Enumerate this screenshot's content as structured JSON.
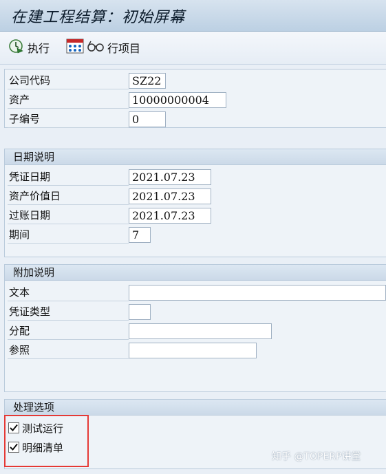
{
  "window": {
    "title": "在建工程结算：初始屏幕"
  },
  "toolbar": {
    "execute_label": "执行",
    "line_items_label": "行项目",
    "execute_icon": "clock-execute-icon",
    "line_items_icons": [
      "grid-icon",
      "glasses-icon"
    ]
  },
  "main": {
    "fields": {
      "company_code": {
        "label": "公司代码",
        "value": "SZ22"
      },
      "asset": {
        "label": "资产",
        "value": "10000000004"
      },
      "sub_number": {
        "label": "子编号",
        "value": "0"
      }
    }
  },
  "dates": {
    "header": "日期说明",
    "document_date": {
      "label": "凭证日期",
      "value": "2021.07.23"
    },
    "asset_value_date": {
      "label": "资产价值日",
      "value": "2021.07.23"
    },
    "posting_date": {
      "label": "过账日期",
      "value": "2021.07.23"
    },
    "period": {
      "label": "期间",
      "value": "7"
    }
  },
  "additional": {
    "header": "附加说明",
    "text": {
      "label": "文本",
      "value": ""
    },
    "document_type": {
      "label": "凭证类型",
      "value": ""
    },
    "assignment": {
      "label": "分配",
      "value": ""
    },
    "reference": {
      "label": "参照",
      "value": ""
    }
  },
  "processing": {
    "header": "处理选项",
    "test_run": {
      "label": "测试运行",
      "checked": true
    },
    "detail_list": {
      "label": "明细清单",
      "checked": true
    }
  },
  "watermark": {
    "text": "知乎 @TOPERP讲堂"
  },
  "colors": {
    "highlight_border": "#e53935",
    "title_bg": "#c8d8e8",
    "panel_bg": "#eef3f8"
  }
}
